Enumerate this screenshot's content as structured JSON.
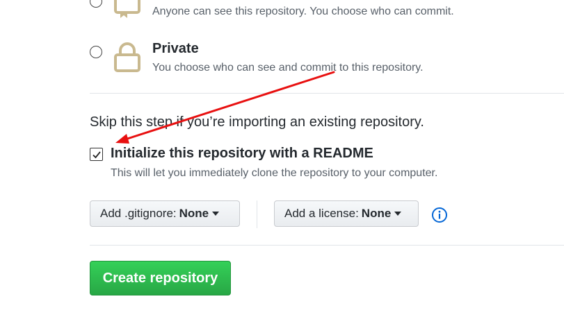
{
  "visibility": {
    "public_description": "Anyone can see this repository. You choose who can commit.",
    "private_title": "Private",
    "private_description": "You choose who can see and commit to this repository."
  },
  "init": {
    "skip_text": "Skip this step if you’re importing an existing repository.",
    "readme_label": "Initialize this repository with a README",
    "readme_description": "This will let you immediately clone the repository to your computer.",
    "readme_checked": true
  },
  "options": {
    "gitignore_label": "Add .gitignore:",
    "gitignore_value": "None",
    "license_label": "Add a license:",
    "license_value": "None"
  },
  "actions": {
    "create_label": "Create repository"
  },
  "colors": {
    "create_button": "#2ea44f",
    "info_icon": "#0366d6",
    "annotation_arrow": "#e81010",
    "lock_icon": "#c9b98f"
  }
}
